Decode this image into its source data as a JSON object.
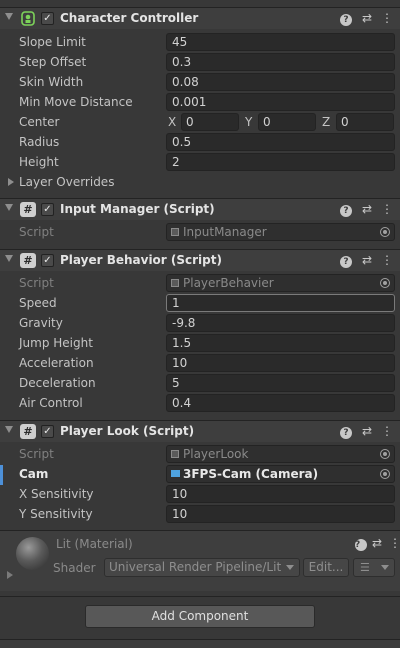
{
  "components": {
    "character_controller": {
      "title": "Character Controller",
      "fields": [
        {
          "label": "Slope Limit",
          "value": "45"
        },
        {
          "label": "Step Offset",
          "value": "0.3"
        },
        {
          "label": "Skin Width",
          "value": "0.08"
        },
        {
          "label": "Min Move Distance",
          "value": "0.001"
        },
        {
          "label": "Radius",
          "value": "0.5"
        },
        {
          "label": "Height",
          "value": "2"
        }
      ],
      "center": {
        "label": "Center",
        "x_label": "X",
        "x": "0",
        "y_label": "Y",
        "y": "0",
        "z_label": "Z",
        "z": "0"
      },
      "layer_overrides": "Layer Overrides"
    },
    "input_manager": {
      "title": "Input Manager (Script)",
      "script_label": "Script",
      "script_value": "InputManager"
    },
    "player_behavior": {
      "title": "Player Behavior (Script)",
      "script_label": "Script",
      "script_value": "PlayerBehavier",
      "fields": [
        {
          "label": "Speed",
          "value": "1"
        },
        {
          "label": "Gravity",
          "value": "-9.8"
        },
        {
          "label": "Jump Height",
          "value": "1.5"
        },
        {
          "label": "Acceleration",
          "value": "10"
        },
        {
          "label": "Deceleration",
          "value": "5"
        },
        {
          "label": "Air Control",
          "value": "0.4"
        }
      ]
    },
    "player_look": {
      "title": "Player Look (Script)",
      "script_label": "Script",
      "script_value": "PlayerLook",
      "cam_label": "Cam",
      "cam_value": "3FPS-Cam (Camera)",
      "fields": [
        {
          "label": "X Sensitivity",
          "value": "10"
        },
        {
          "label": "Y Sensitivity",
          "value": "10"
        }
      ]
    }
  },
  "material": {
    "title": "Lit (Material)",
    "shader_label": "Shader",
    "shader_value": "Universal Render Pipeline/Lit",
    "edit_label": "Edit..."
  },
  "add_component_label": "Add Component",
  "icons": {
    "help": "?",
    "presets": "⇄",
    "more": "⋮",
    "script_hash": "#",
    "check": "✓"
  }
}
